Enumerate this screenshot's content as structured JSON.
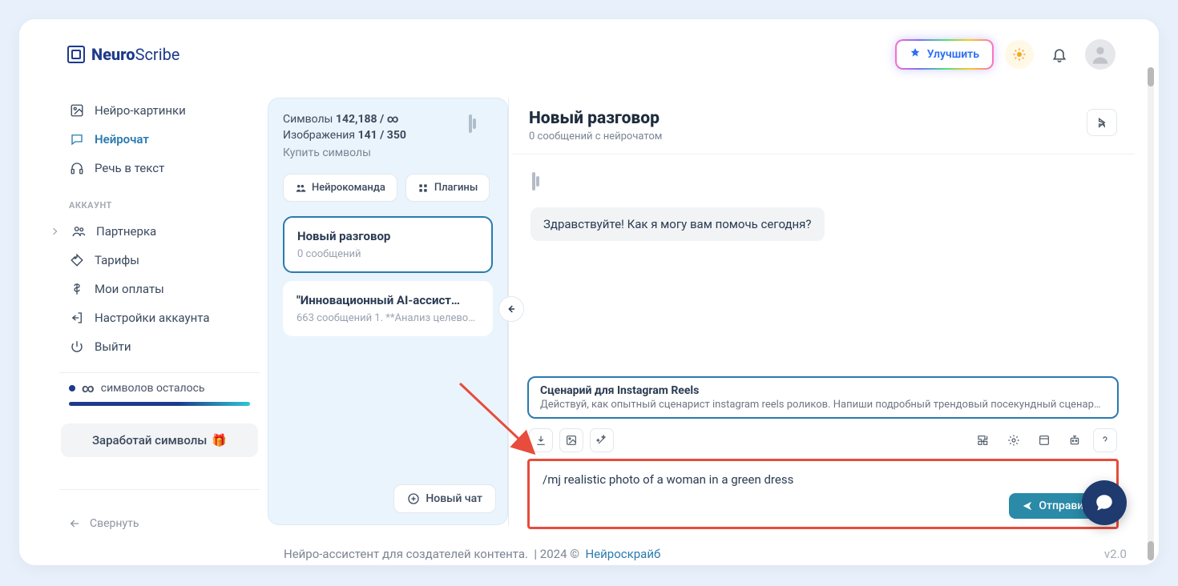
{
  "brand": {
    "name_strong": "Neuro",
    "name_rest": "Scribe"
  },
  "header": {
    "upgrade": "Улучшить"
  },
  "sidebar": {
    "items": [
      {
        "label": "Нейро-картинки"
      },
      {
        "label": "Нейрочат"
      },
      {
        "label": "Речь в текст"
      }
    ],
    "account_label": "АККАУНТ",
    "account_items": [
      {
        "label": "Партнерка"
      },
      {
        "label": "Тарифы"
      },
      {
        "label": "Мои оплаты"
      },
      {
        "label": "Настройки аккаунта"
      },
      {
        "label": "Выйти"
      }
    ],
    "remaining_prefix": "∞",
    "remaining_text": "символов осталось",
    "earn": "Заработай символы",
    "earn_emoji": "🎁",
    "collapse": "Свернуть"
  },
  "chatlist": {
    "symbols_label": "Символы",
    "symbols_value": "142,188 / ∞",
    "images_label": "Изображения",
    "images_value": "141 / 350",
    "buy": "Купить символы",
    "pill_team": "Нейрокоманда",
    "pill_plugins": "Плагины",
    "conversations": [
      {
        "title": "Новый разговор",
        "sub": "0 сообщений"
      },
      {
        "title": "\"Инновационный AI-ассист…",
        "sub": "663 сообщений 1. **Анализ целевой …"
      }
    ],
    "new_chat": "Новый чат"
  },
  "chat": {
    "title": "Новый разговор",
    "sub": "0 сообщений с нейрочатом",
    "greeting": "Здравствуйте! Как я могу вам помочь сегодня?",
    "template_title": "Сценарий для Instagram Reels",
    "template_text": "Действуй, как опытный сценарист instagram reels роликов. Напиши подробный трендовый посекундный сценари…",
    "composer_value": "/mj realistic photo of a woman in a green dress",
    "send": "Отправить"
  },
  "footer": {
    "tagline": "Нейро-ассистент для создателей контента.",
    "year": "| 2024 ©",
    "brand_link": "Нейроскрайб",
    "version": "v2.0"
  }
}
